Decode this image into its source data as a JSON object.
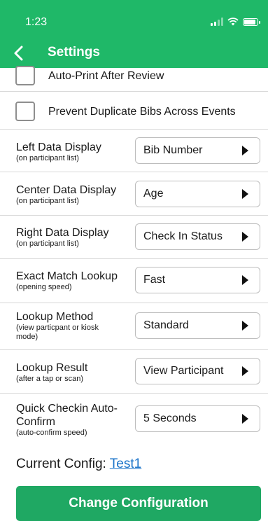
{
  "status_bar": {
    "time": "1:23"
  },
  "header": {
    "title": "Settings"
  },
  "checkboxes": [
    {
      "label": "Auto-Print After Review",
      "checked": false
    },
    {
      "label": "Prevent Duplicate Bibs Across Events",
      "checked": false
    }
  ],
  "settings": [
    {
      "label": "Left Data Display",
      "sublabel": "(on participant list)",
      "value": "Bib Number"
    },
    {
      "label": "Center Data Display",
      "sublabel": "(on participant list)",
      "value": "Age"
    },
    {
      "label": "Right Data Display",
      "sublabel": "(on participant list)",
      "value": "Check In Status"
    },
    {
      "label": "Exact Match Lookup",
      "sublabel": "(opening speed)",
      "value": "Fast"
    },
    {
      "label": "Lookup Method",
      "sublabel": "(view particpant or kiosk mode)",
      "value": "Standard"
    },
    {
      "label": "Lookup Result",
      "sublabel": "(after a tap or scan)",
      "value": "View Participant"
    },
    {
      "label": "Quick Checkin Auto-Confirm",
      "sublabel": "(auto-confirm speed)",
      "value": "5 Seconds"
    }
  ],
  "config": {
    "label": "Current Config:",
    "name": "Test1"
  },
  "actions": {
    "change_config": "Change Configuration"
  },
  "colors": {
    "header": "#1fb868",
    "button": "#1fa863",
    "link": "#1a73c9"
  }
}
